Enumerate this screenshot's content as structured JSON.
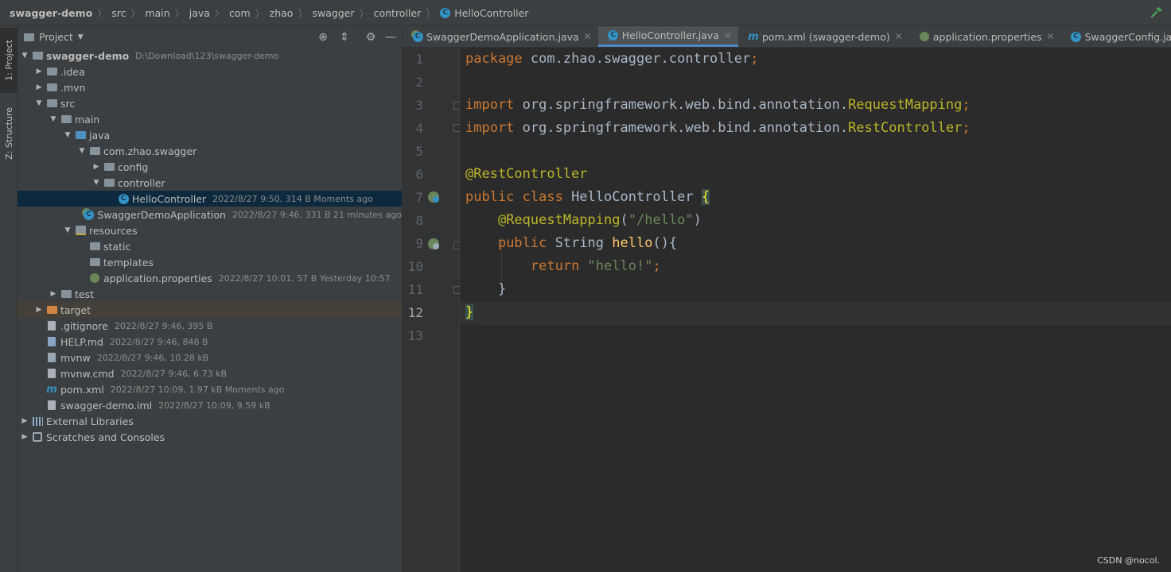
{
  "breadcrumb": [
    "swagger-demo",
    "src",
    "main",
    "java",
    "com",
    "zhao",
    "swagger",
    "controller",
    "HelloController"
  ],
  "side_tabs": {
    "project": "1: Project",
    "structure": "Z: Structure"
  },
  "project_panel": {
    "title": "Project",
    "tree": [
      {
        "name": "swagger-demo",
        "meta": "D:\\Download\\123\\swagger-demo",
        "depth": 0,
        "arrow": "down",
        "icon": "module",
        "bold": true
      },
      {
        "name": ".idea",
        "meta": "",
        "depth": 1,
        "arrow": "right",
        "icon": "folder"
      },
      {
        "name": ".mvn",
        "meta": "",
        "depth": 1,
        "arrow": "right",
        "icon": "folder"
      },
      {
        "name": "src",
        "meta": "",
        "depth": 1,
        "arrow": "down",
        "icon": "folder"
      },
      {
        "name": "main",
        "meta": "",
        "depth": 2,
        "arrow": "down",
        "icon": "folder"
      },
      {
        "name": "java",
        "meta": "",
        "depth": 3,
        "arrow": "down",
        "icon": "folder-blue"
      },
      {
        "name": "com.zhao.swagger",
        "meta": "",
        "depth": 4,
        "arrow": "down",
        "icon": "package"
      },
      {
        "name": "config",
        "meta": "",
        "depth": 5,
        "arrow": "right",
        "icon": "package"
      },
      {
        "name": "controller",
        "meta": "",
        "depth": 5,
        "arrow": "down",
        "icon": "package"
      },
      {
        "name": "HelloController",
        "meta": "2022/8/27 9:50, 314 B  Moments ago",
        "depth": 6,
        "arrow": "",
        "icon": "class",
        "selected": true
      },
      {
        "name": "SwaggerDemoApplication",
        "meta": "2022/8/27 9:46, 331 B  21 minutes ago",
        "depth": 5,
        "arrow": "",
        "icon": "spring-class"
      },
      {
        "name": "resources",
        "meta": "",
        "depth": 3,
        "arrow": "down",
        "icon": "folder-res"
      },
      {
        "name": "static",
        "meta": "",
        "depth": 4,
        "arrow": "",
        "icon": "folder"
      },
      {
        "name": "templates",
        "meta": "",
        "depth": 4,
        "arrow": "",
        "icon": "folder"
      },
      {
        "name": "application.properties",
        "meta": "2022/8/27 10:01, 57 B  Yesterday 10:57",
        "depth": 4,
        "arrow": "",
        "icon": "spring-props"
      },
      {
        "name": "test",
        "meta": "",
        "depth": 2,
        "arrow": "right",
        "icon": "folder"
      },
      {
        "name": "target",
        "meta": "",
        "depth": 1,
        "arrow": "right",
        "icon": "folder-orange",
        "excluded": true
      },
      {
        "name": ".gitignore",
        "meta": "2022/8/27 9:46, 395 B",
        "depth": 1,
        "arrow": "",
        "icon": "file"
      },
      {
        "name": "HELP.md",
        "meta": "2022/8/27 9:46, 848 B",
        "depth": 1,
        "arrow": "",
        "icon": "md"
      },
      {
        "name": "mvnw",
        "meta": "2022/8/27 9:46, 10.28 kB",
        "depth": 1,
        "arrow": "",
        "icon": "exec"
      },
      {
        "name": "mvnw.cmd",
        "meta": "2022/8/27 9:46, 6.73 kB",
        "depth": 1,
        "arrow": "",
        "icon": "file"
      },
      {
        "name": "pom.xml",
        "meta": "2022/8/27 10:09, 1.97 kB  Moments ago",
        "depth": 1,
        "arrow": "",
        "icon": "maven"
      },
      {
        "name": "swagger-demo.iml",
        "meta": "2022/8/27 10:09, 9.59 kB",
        "depth": 1,
        "arrow": "",
        "icon": "file"
      },
      {
        "name": "External Libraries",
        "meta": "",
        "depth": 0,
        "arrow": "right",
        "icon": "libs"
      },
      {
        "name": "Scratches and Consoles",
        "meta": "",
        "depth": 0,
        "arrow": "right",
        "icon": "scratch"
      }
    ]
  },
  "tabs": [
    {
      "label": "SwaggerDemoApplication.java",
      "icon": "spring-class",
      "active": false
    },
    {
      "label": "HelloController.java",
      "icon": "class",
      "active": true
    },
    {
      "label": "pom.xml (swagger-demo)",
      "icon": "maven",
      "active": false
    },
    {
      "label": "application.properties",
      "icon": "spring-props",
      "active": false
    },
    {
      "label": "SwaggerConfig.java",
      "icon": "class",
      "active": false
    }
  ],
  "editor": {
    "current_line": 12,
    "line_numbers": [
      "1",
      "2",
      "3",
      "4",
      "5",
      "6",
      "7",
      "8",
      "9",
      "10",
      "11",
      "12",
      "13"
    ],
    "lines": [
      [
        {
          "t": "package ",
          "c": "kw"
        },
        {
          "t": "com.zhao.swagger.controller",
          "c": ""
        },
        {
          "t": ";",
          "c": "kw"
        }
      ],
      [],
      [
        {
          "t": "import ",
          "c": "kw"
        },
        {
          "t": "org.springframework.web.bind.annotation.",
          "c": ""
        },
        {
          "t": "RequestMapping",
          "c": "ann"
        },
        {
          "t": ";",
          "c": "kw"
        }
      ],
      [
        {
          "t": "import ",
          "c": "kw"
        },
        {
          "t": "org.springframework.web.bind.annotation.",
          "c": ""
        },
        {
          "t": "RestController",
          "c": "ann"
        },
        {
          "t": ";",
          "c": "kw"
        }
      ],
      [],
      [
        {
          "t": "@RestController",
          "c": "ann"
        }
      ],
      [
        {
          "t": "public class ",
          "c": "kw"
        },
        {
          "t": "HelloController ",
          "c": ""
        },
        {
          "t": "{",
          "c": "brace-hl"
        }
      ],
      [
        {
          "t": "    ",
          "c": ""
        },
        {
          "t": "@RequestMapping",
          "c": "ann"
        },
        {
          "t": "(",
          "c": ""
        },
        {
          "t": "\"/hello\"",
          "c": "str"
        },
        {
          "t": ")",
          "c": ""
        }
      ],
      [
        {
          "t": "    ",
          "c": ""
        },
        {
          "t": "public ",
          "c": "kw"
        },
        {
          "t": "String ",
          "c": ""
        },
        {
          "t": "hello",
          "c": "fn"
        },
        {
          "t": "(){",
          "c": ""
        }
      ],
      [
        {
          "t": "        ",
          "c": ""
        },
        {
          "t": "return ",
          "c": "kw"
        },
        {
          "t": "\"hello!\"",
          "c": "str"
        },
        {
          "t": ";",
          "c": "kw"
        }
      ],
      [
        {
          "t": "    }",
          "c": ""
        }
      ],
      [
        {
          "t": "}",
          "c": "brace-hl"
        }
      ],
      []
    ]
  },
  "watermark": "CSDN @nocol."
}
